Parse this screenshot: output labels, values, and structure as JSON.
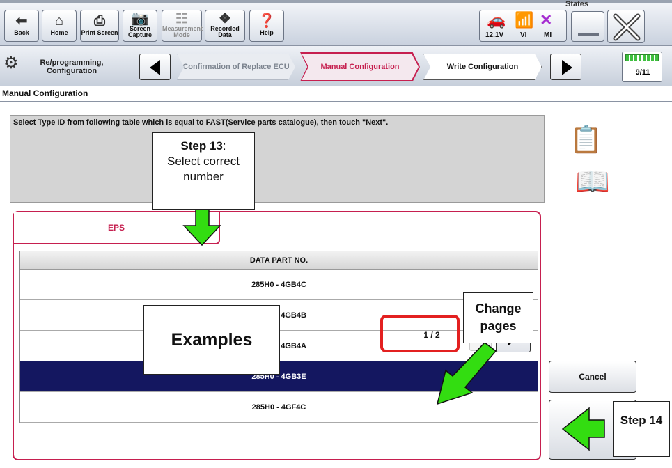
{
  "toolbar": {
    "states_label": "States",
    "buttons": [
      {
        "label": "Back",
        "icon": "back-arrow-icon"
      },
      {
        "label": "Home",
        "icon": "home-icon"
      },
      {
        "label": "Print Screen",
        "icon": "printer-icon"
      },
      {
        "label": "Screen Capture",
        "icon": "camera-icon"
      },
      {
        "label": "Measurement Mode",
        "icon": "measurement-icon"
      },
      {
        "label": "Recorded Data",
        "icon": "recorded-data-icon"
      },
      {
        "label": "Help",
        "icon": "help-icon"
      }
    ],
    "status": {
      "voltage": "12.1V",
      "vi": "VI",
      "mi": "MI"
    }
  },
  "progress": {
    "section_label": "Re/programming, Configuration",
    "steps": [
      {
        "label": "Confirmation of Replace ECU",
        "state": "done"
      },
      {
        "label": "Manual Configuration",
        "state": "current"
      },
      {
        "label": "Write Configuration",
        "state": "next"
      }
    ],
    "page_counter": "9/11"
  },
  "page_title": "Manual Configuration",
  "instruction": "Select Type ID from following table which is equal to FAST(Service parts catalogue), then touch \"Next\".",
  "tab": {
    "label": "EPS"
  },
  "table": {
    "header": "DATA PART NO.",
    "rows": [
      {
        "value": "285H0 - 4GB4C",
        "selected": false
      },
      {
        "value": "285H0 - 4GB4B",
        "selected": false
      },
      {
        "value": "285H0 - 4GB4A",
        "selected": false
      },
      {
        "value": "285H0 - 4GB3E",
        "selected": true
      },
      {
        "value": "285H0 - 4GF4C",
        "selected": false
      }
    ]
  },
  "pager": {
    "text": "1 / 2"
  },
  "buttons": {
    "cancel": "Cancel"
  },
  "annotations": {
    "step13_title": "Step 13",
    "step13_text": "Select correct number",
    "examples": "Examples",
    "change_pages": "Change pages",
    "step14": "Step 14"
  },
  "colors": {
    "accent": "#c61f4f",
    "selected_row": "#141760",
    "highlight_box": "#e32020",
    "arrow_green": "#33dd11"
  }
}
